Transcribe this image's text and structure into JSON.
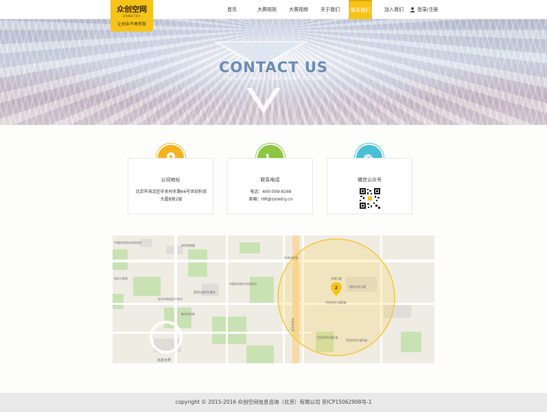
{
  "logo": {
    "brand": "众创空网",
    "sub": "ZONETRY",
    "slogan": "让创业不再失败"
  },
  "nav": {
    "items": [
      {
        "label": "首页"
      },
      {
        "label": "大赛规则"
      },
      {
        "label": "大赛视频"
      },
      {
        "label": "关于我们"
      },
      {
        "label": "联系我们"
      },
      {
        "label": "加入我们"
      }
    ],
    "active": "联系我们",
    "login": "登录/注册"
  },
  "banner": {
    "title": "CONTACT  US",
    "subtitle": "TELL US WHAT YOU WANT TO SAY"
  },
  "cards": [
    {
      "title": "公司地址",
      "lines": [
        "北京市海淀区中关村东路66号世纪科贸",
        "大厦B座2层"
      ],
      "color": "#f5b21f",
      "icon": "location-pin-icon"
    },
    {
      "title": "联系电话",
      "lines": [
        "电话：400-009-8166",
        "邮箱：HR@zonetry.cn"
      ],
      "color": "#8ac63f",
      "icon": "phone-icon"
    },
    {
      "title": "微信公众号",
      "lines": [],
      "color": "#49c0d6",
      "icon": "wechat-icon"
    }
  ],
  "map": {
    "labels": [
      "中国科学院化学研究所",
      "北京市海淀区中关村",
      "科学院南路",
      "中关村大街",
      "国际文化大厦",
      "世纪科贸大厦B座",
      "世纪科贸大厦C座",
      "世纪科贸大厦D座",
      "长城大厦",
      "海淀工商局",
      "中关村东路",
      "中国科学院力学研究所",
      "数学科学院",
      "北京大学",
      "国家自然科学基金"
    ]
  },
  "footer": {
    "text": "copyright © 2015-2016 众创空间信息咨询（北京）有限公司   京ICP15062908号-1"
  }
}
